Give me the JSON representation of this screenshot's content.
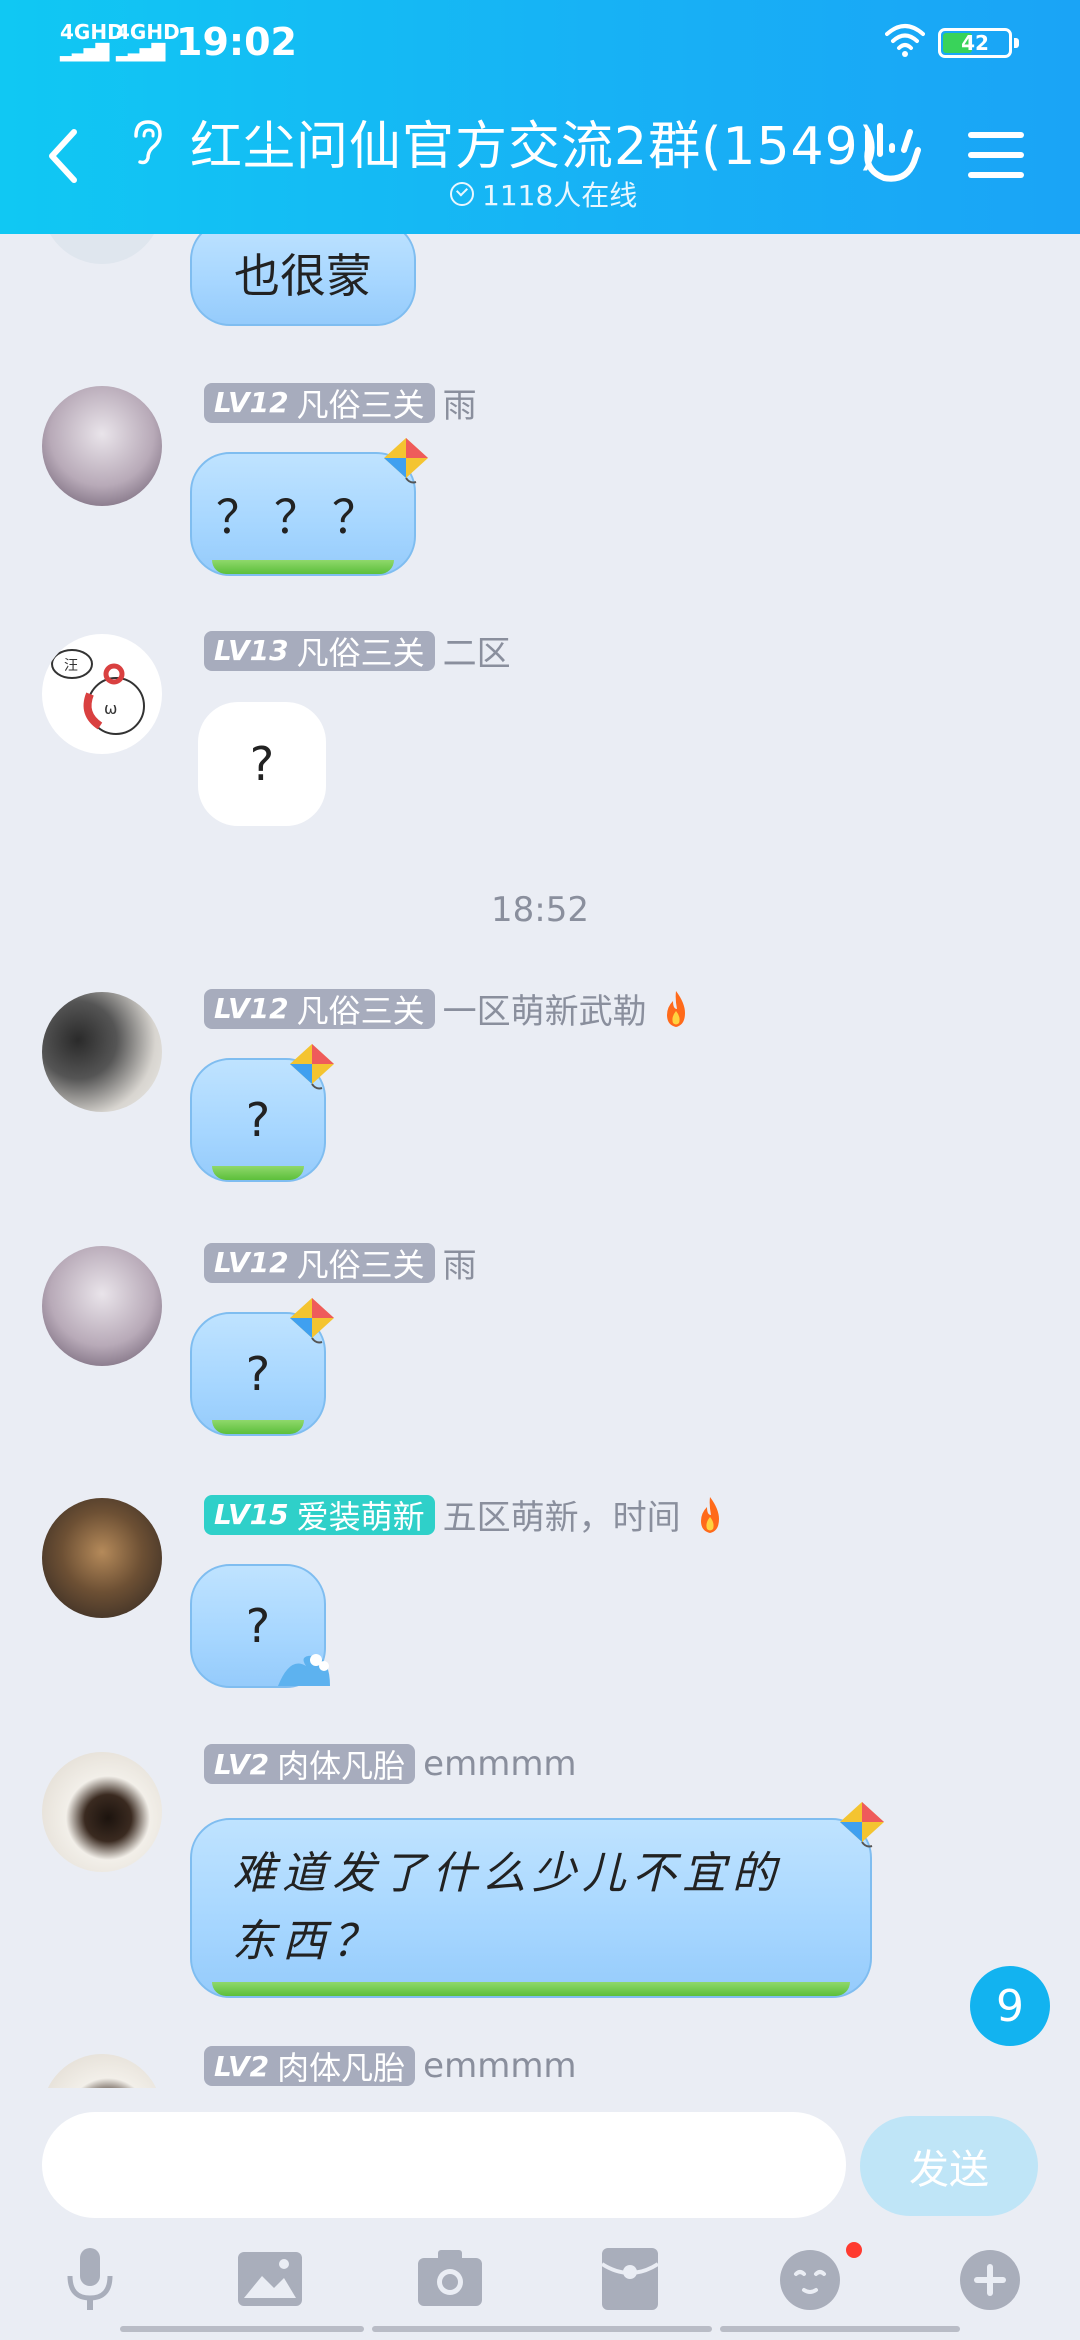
{
  "status": {
    "net1": "4GHD",
    "net2": "4GHD",
    "time": "19:02",
    "battery": "42"
  },
  "header": {
    "title": "红尘问仙官方交流2群(1549)",
    "online": "1118人在线"
  },
  "messages": [
    {
      "text": "也很蒙"
    },
    {
      "level": "LV12",
      "rank": "凡俗三关",
      "nick": "雨",
      "text": "？？？"
    },
    {
      "level": "LV13",
      "rank": "凡俗三关",
      "nick": "二区",
      "text": "?"
    },
    {
      "level": "LV12",
      "rank": "凡俗三关",
      "nick": "一区萌新武勒",
      "text": "?"
    },
    {
      "level": "LV12",
      "rank": "凡俗三关",
      "nick": "雨",
      "text": "?"
    },
    {
      "level": "LV15",
      "rank": "爱装萌新",
      "nick": "五区萌新，时间",
      "text": "?"
    },
    {
      "level": "LV2",
      "rank": "肉体凡胎",
      "nick": "emmmm",
      "text": "难道发了什么少儿不宜的东西？"
    },
    {
      "level": "LV2",
      "rank": "肉体凡胎",
      "nick": "emmmm"
    }
  ],
  "timestamp": "18:52",
  "unread_count": "9",
  "input": {
    "placeholder": "",
    "send_label": "发送"
  },
  "colors": {
    "header": "#17b2f5",
    "bubble_blue": "#a6d6ff",
    "level_badge": "#a7acbd",
    "level_badge_teal": "#2fd0c9",
    "unread": "#12b3f0"
  },
  "icons": [
    "back-icon",
    "ear-icon",
    "hand-icon",
    "menu-icon",
    "mic-icon",
    "image-icon",
    "camera-icon",
    "redpacket-icon",
    "emoji-icon",
    "plus-icon"
  ]
}
